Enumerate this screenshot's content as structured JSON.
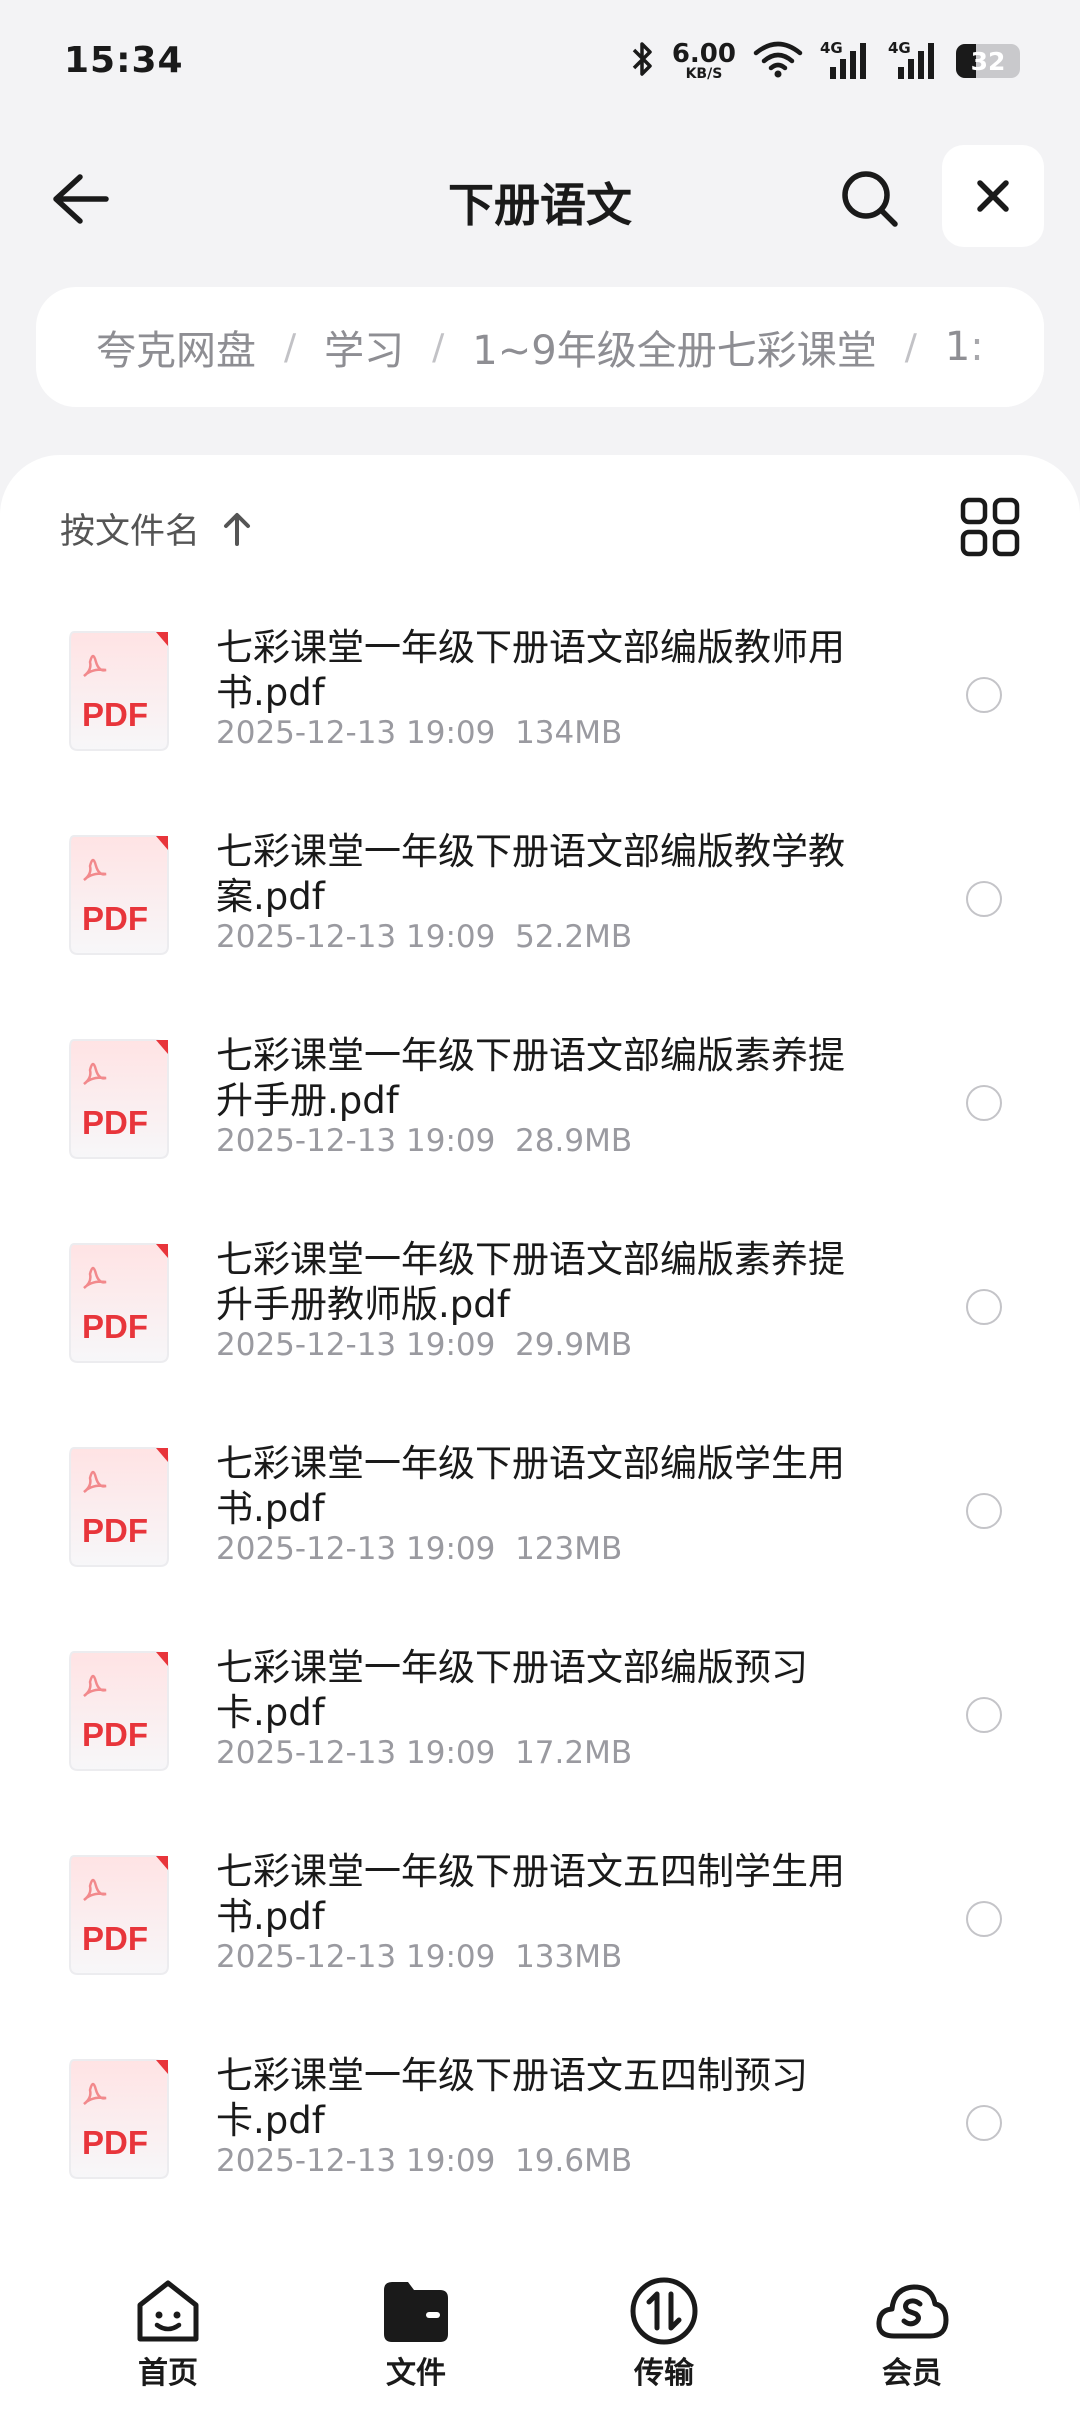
{
  "status_bar": {
    "time": "15:34",
    "network_speed": "6.00",
    "network_speed_unit": "KB/S",
    "signal_1": "4G",
    "signal_2": "4G",
    "battery": "32",
    "battery_level": 0.32
  },
  "header": {
    "title": "下册语文"
  },
  "breadcrumb": [
    "夸克网盘",
    "学习",
    "1~9年级全册七彩课堂",
    "1:"
  ],
  "toolbar": {
    "sort_label": "按文件名"
  },
  "files": [
    {
      "name": "七彩课堂一年级下册语文部编版教师用书.pdf",
      "date": "2025-12-13 19:09",
      "size": "134MB",
      "icon": "pdf-icon",
      "icon_label": "PDF"
    },
    {
      "name": "七彩课堂一年级下册语文部编版教学教案.pdf",
      "date": "2025-12-13 19:09",
      "size": "52.2MB",
      "icon": "pdf-icon",
      "icon_label": "PDF"
    },
    {
      "name": "七彩课堂一年级下册语文部编版素养提升手册.pdf",
      "date": "2025-12-13 19:09",
      "size": "28.9MB",
      "icon": "pdf-icon",
      "icon_label": "PDF"
    },
    {
      "name": "七彩课堂一年级下册语文部编版素养提升手册教师版.pdf",
      "date": "2025-12-13 19:09",
      "size": "29.9MB",
      "icon": "pdf-icon",
      "icon_label": "PDF"
    },
    {
      "name": "七彩课堂一年级下册语文部编版学生用书.pdf",
      "date": "2025-12-13 19:09",
      "size": "123MB",
      "icon": "pdf-icon",
      "icon_label": "PDF"
    },
    {
      "name": "七彩课堂一年级下册语文部编版预习卡.pdf",
      "date": "2025-12-13 19:09",
      "size": "17.2MB",
      "icon": "pdf-icon",
      "icon_label": "PDF"
    },
    {
      "name": "七彩课堂一年级下册语文五四制学生用书.pdf",
      "date": "2025-12-13 19:09",
      "size": "133MB",
      "icon": "pdf-icon",
      "icon_label": "PDF"
    },
    {
      "name": "七彩课堂一年级下册语文五四制预习卡.pdf",
      "date": "2025-12-13 19:09",
      "size": "19.6MB",
      "icon": "pdf-icon",
      "icon_label": "PDF"
    }
  ],
  "bottom_nav": [
    {
      "label": "首页",
      "icon": "home-icon"
    },
    {
      "label": "文件",
      "icon": "folder-icon",
      "active": true
    },
    {
      "label": "传输",
      "icon": "transfer-icon"
    },
    {
      "label": "会员",
      "icon": "member-icon"
    }
  ],
  "colors": {
    "background": "#f3f3f5",
    "surface": "#ffffff",
    "text_primary": "#1a1a1a",
    "text_secondary": "#9a9aa0",
    "pdf_red": "#e8353b"
  }
}
